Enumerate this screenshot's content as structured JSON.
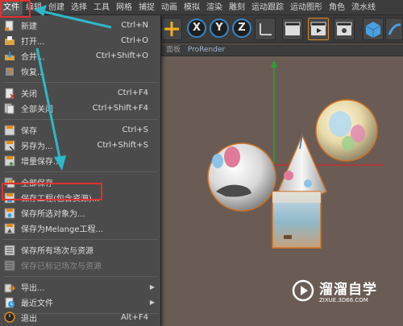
{
  "menubar": {
    "items": [
      "文件",
      "编辑",
      "创建",
      "选择",
      "工具",
      "网格",
      "捕捉",
      "动画",
      "模拟",
      "渲染",
      "雕刻",
      "运动跟踪",
      "运动图形",
      "角色",
      "流水线"
    ]
  },
  "toolbar": {
    "axes": [
      "X",
      "Y",
      "Z"
    ]
  },
  "viewport": {
    "tab_label": "面板",
    "renderer_label": "ProRender"
  },
  "file_menu": {
    "items": [
      {
        "label": "新建",
        "shortcut": "Ctrl+N",
        "icon": "new-file-icon"
      },
      {
        "label": "打开...",
        "shortcut": "Ctrl+O",
        "icon": "open-folder-icon"
      },
      {
        "label": "合并...",
        "shortcut": "Ctrl+Shift+O",
        "icon": "merge-icon"
      },
      {
        "label": "恢复...",
        "shortcut": "",
        "icon": "revert-icon"
      },
      {
        "label": "关闭",
        "shortcut": "Ctrl+F4",
        "icon": "close-file-icon"
      },
      {
        "label": "全部关闭",
        "shortcut": "Ctrl+Shift+F4",
        "icon": "close-all-icon"
      },
      {
        "label": "保存",
        "shortcut": "Ctrl+S",
        "icon": "save-icon"
      },
      {
        "label": "另存为...",
        "shortcut": "Ctrl+Shift+S",
        "icon": "save-as-icon"
      },
      {
        "label": "增量保存...",
        "shortcut": "",
        "icon": "incremental-save-icon"
      },
      {
        "label": "全部保存",
        "shortcut": "",
        "icon": "save-all-icon"
      },
      {
        "label": "保存工程(包含资源)...",
        "shortcut": "",
        "icon": "save-project-icon"
      },
      {
        "label": "保存所选对象为...",
        "shortcut": "",
        "icon": "save-selected-icon"
      },
      {
        "label": "保存为Melange工程...",
        "shortcut": "",
        "icon": "save-melange-icon"
      },
      {
        "label": "保存所有场次与资源",
        "shortcut": "",
        "icon": "save-takes-icon"
      },
      {
        "label": "保存已标记场次与资源",
        "shortcut": "",
        "icon": "save-marked-takes-icon"
      },
      {
        "label": "导出...",
        "shortcut": "",
        "icon": "export-icon"
      },
      {
        "label": "最近文件",
        "shortcut": "",
        "icon": "recent-files-icon"
      },
      {
        "label": "退出",
        "shortcut": "Alt+F4",
        "icon": "exit-icon"
      }
    ]
  },
  "watermark": {
    "title": "溜溜自学",
    "url": "ZIXUE.3D66.COM"
  },
  "colors": {
    "highlight_box": "#e23030",
    "annotation_arrow": "#2fb8c8",
    "menu_bg": "#4b4b4b",
    "viewport_bg": "#6a5c55"
  }
}
